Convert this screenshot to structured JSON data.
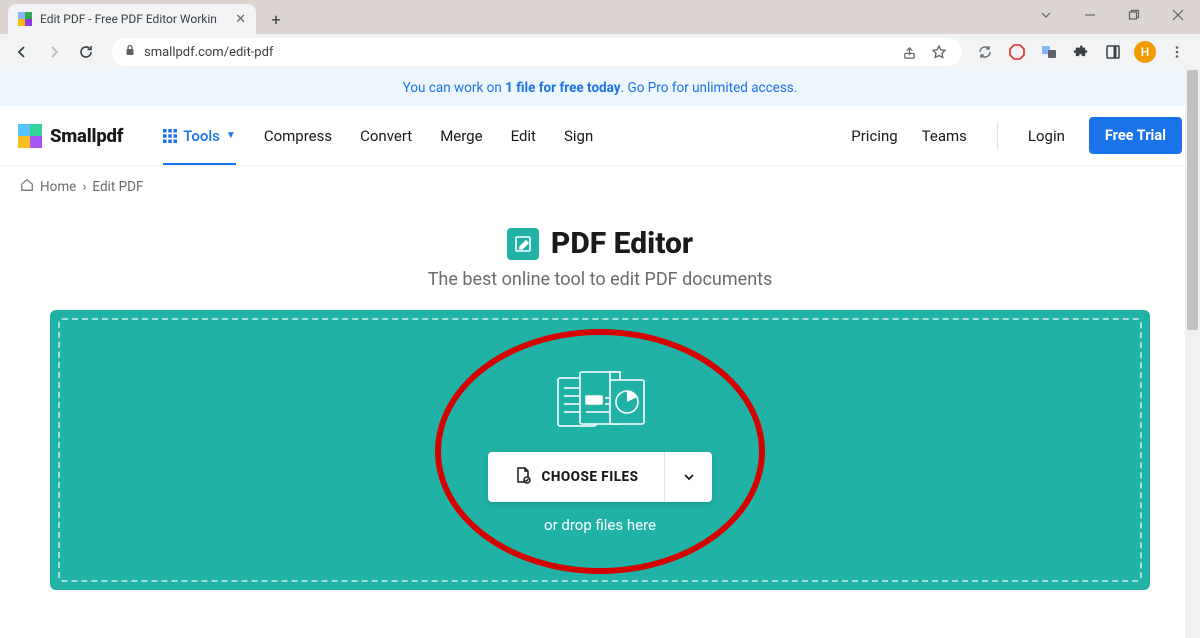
{
  "browser": {
    "tab_title": "Edit PDF - Free PDF Editor Workin",
    "url": "smallpdf.com/edit-pdf",
    "avatar_letter": "H"
  },
  "promo": {
    "prefix": "You can work on ",
    "bold": "1 file for free today",
    "suffix": ". Go Pro for unlimited access."
  },
  "header": {
    "logo": "Smallpdf",
    "menu": {
      "tools": "Tools",
      "compress": "Compress",
      "convert": "Convert",
      "merge": "Merge",
      "edit": "Edit",
      "sign": "Sign"
    },
    "right": {
      "pricing": "Pricing",
      "teams": "Teams",
      "login": "Login",
      "free_trial": "Free Trial"
    }
  },
  "breadcrumb": {
    "home": "Home",
    "sep": "›",
    "current": "Edit PDF"
  },
  "hero": {
    "title": "PDF Editor",
    "subtitle": "The best online tool to edit PDF documents"
  },
  "drop": {
    "choose": "CHOOSE FILES",
    "hint": "or drop files here"
  }
}
